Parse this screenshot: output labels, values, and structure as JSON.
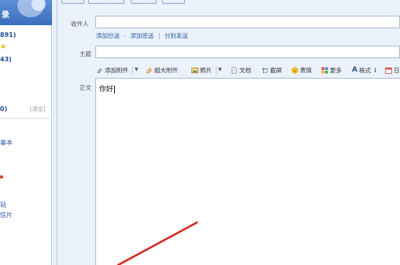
{
  "sidebar": {
    "title": "录",
    "lines": [
      {
        "text": "891)",
        "style": "bold"
      },
      {
        "text": "43)",
        "style": "bold"
      },
      {
        "text": "0)",
        "style": "bold"
      },
      {
        "text": "事本",
        "style": "normal"
      },
      {
        "text": "站",
        "style": "normal"
      },
      {
        "text": "信片",
        "style": "normal"
      }
    ],
    "clear_label": "[清空]"
  },
  "compose": {
    "to_label": "收件人",
    "add_cc": "添加抄送",
    "add_bcc": "添加密送",
    "separate_send": "分别发送",
    "link_dash": "-",
    "link_sep": "|",
    "subject_label": "主题",
    "body_label": "正文",
    "body_text": "你好"
  },
  "toolbar": {
    "attach": "添加附件",
    "big_attach": "超大附件",
    "photo": "照片",
    "doc": "文档",
    "screenshot": "截屏",
    "emoji": "表情",
    "more": "更多",
    "format": "格式",
    "date": "日"
  },
  "colors": {
    "sidebar_header": "#3a6fbe",
    "panel_bg": "#ebf2fb",
    "link": "#2a5aa3",
    "arrow": "#d42a1e"
  }
}
